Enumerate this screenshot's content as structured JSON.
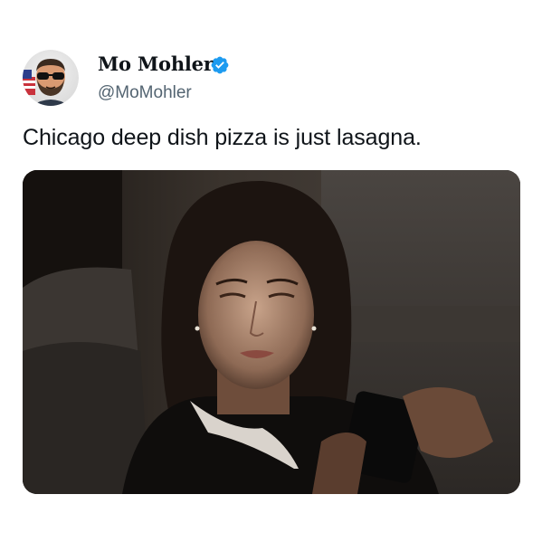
{
  "tweet": {
    "author": {
      "display_name": "Mo Mohler",
      "handle": "@MoMohler",
      "verified": true,
      "avatar_icon": "avatar-man-sunglasses-beard"
    },
    "text": "Chicago deep dish pizza is just lasagna.",
    "media": {
      "type": "photo",
      "icon": "woman-looking-at-phone-in-dark"
    }
  },
  "colors": {
    "text_primary": "#0f1419",
    "text_secondary": "#536471",
    "verified_blue": "#1d9bf0",
    "background": "#ffffff"
  }
}
